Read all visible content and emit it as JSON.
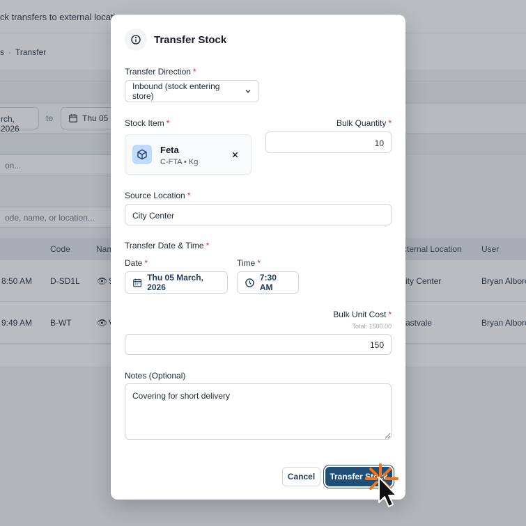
{
  "background": {
    "banner_text": "ck transfers to external locations",
    "breadcrumb": [
      "s",
      "Transfer"
    ],
    "date_from": "rch, 2026",
    "date_to_label": "to",
    "date_to": "Thu 05",
    "filter_placeholder": "on...",
    "search_placeholder": "ode, name, or location...",
    "table": {
      "headers": {
        "code": "Code",
        "name": "Nam",
        "external_location": "xternal Location",
        "user": "User"
      },
      "rows": [
        {
          "time": "8:50 AM",
          "code": "D-SD1L",
          "name": "S",
          "location": "ity Center",
          "user": "Bryan Alborc"
        },
        {
          "time": "9:49 AM",
          "code": "B-WT",
          "name": "V",
          "location": "astvale",
          "user": "Bryan Alborc"
        }
      ]
    }
  },
  "modal": {
    "title": "Transfer Stock",
    "header_icon": "info-icon",
    "direction": {
      "label": "Transfer Direction",
      "value": "Inbound (stock entering store)"
    },
    "stock_item": {
      "label": "Stock Item",
      "name": "Feta",
      "meta": "C-FTA • Kg",
      "icon": "cube-icon"
    },
    "bulk_quantity": {
      "label": "Bulk Quantity",
      "value": "10"
    },
    "source_location": {
      "label": "Source Location",
      "value": "City Center"
    },
    "transfer_datetime": {
      "label": "Transfer Date & Time"
    },
    "date": {
      "label": "Date",
      "value": "Thu 05 March, 2026"
    },
    "time": {
      "label": "Time",
      "value": "7:30 AM"
    },
    "bulk_unit_cost": {
      "label": "Bulk Unit Cost",
      "total": "Total: 1500.00",
      "value": "150"
    },
    "notes": {
      "label": "Notes (Optional)",
      "value": "Covering for short delivery"
    },
    "required_mark": "*",
    "cancel_label": "Cancel",
    "submit_label": "Transfer Stock"
  },
  "colors": {
    "primary": "#1f4e79",
    "required": "#dc2626",
    "cursor_highlight": "#f97316"
  }
}
